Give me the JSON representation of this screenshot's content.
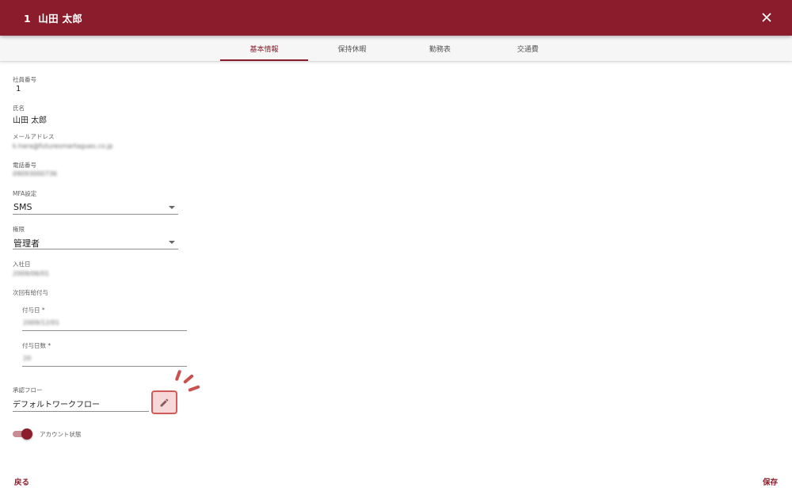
{
  "header": {
    "title": "1  山田 太郎",
    "close_icon": "close-icon"
  },
  "tabs": [
    {
      "label": "基本情報",
      "active": true
    },
    {
      "label": "保持休暇",
      "active": false
    },
    {
      "label": "勤務表",
      "active": false
    },
    {
      "label": "交通費",
      "active": false
    }
  ],
  "fields": {
    "employee_number": {
      "label": "社員番号",
      "value": "1"
    },
    "name": {
      "label": "氏名",
      "value": "山田 太郎"
    },
    "email": {
      "label": "メールアドレス",
      "value": "k.hara@futuresmartagues.co.jp"
    },
    "phone": {
      "label": "電話番号",
      "value": "09093000736"
    },
    "mfa": {
      "label": "MFA設定",
      "value": "SMS"
    },
    "role": {
      "label": "権限",
      "value": "管理者"
    },
    "join_date": {
      "label": "入社日",
      "value": "2009/06/01"
    },
    "next_grant": {
      "label": "次回有給付与",
      "grant_date": {
        "label": "付与日 *",
        "value": "2009/12/01"
      },
      "grant_days": {
        "label": "付与日数 *",
        "value": "20"
      }
    },
    "approval_flow": {
      "label": "承認フロー",
      "value": "デフォルトワークフロー",
      "edit_icon": "pencil-icon"
    },
    "account_status": {
      "label": "アカウント状態",
      "enabled": true
    }
  },
  "footer": {
    "back_label": "戻る",
    "save_label": "保存"
  },
  "colors": {
    "primary": "#8a1c2b",
    "highlight": "#d45a5a"
  }
}
